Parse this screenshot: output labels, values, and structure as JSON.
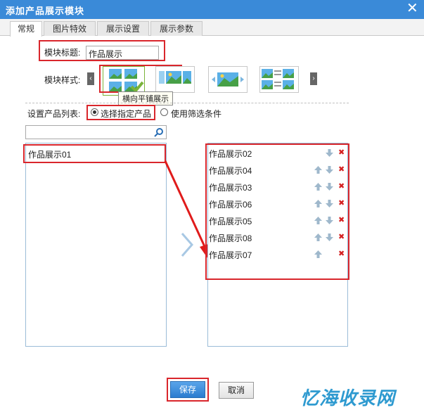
{
  "dialog": {
    "title": "添加产品展示模块",
    "close_glyph": "✕"
  },
  "tabs": [
    {
      "label": "常规",
      "active": true
    },
    {
      "label": "图片特效",
      "active": false
    },
    {
      "label": "展示设置",
      "active": false
    },
    {
      "label": "展示参数",
      "active": false
    }
  ],
  "module_title": {
    "label": "模块标题:",
    "value": "作品展示"
  },
  "module_style": {
    "label": "模块样式:",
    "tooltip": "横向平铺展示",
    "prev_icon": "chevron-left-icon",
    "next_icon": "chevron-right-icon"
  },
  "product_list": {
    "label": "设置产品列表:",
    "option_specific": "选择指定产品",
    "option_filter": "使用筛选条件",
    "selected": "option_specific"
  },
  "search": {
    "value": "",
    "icon": "search-icon"
  },
  "available_items": [
    "作品展示01"
  ],
  "selected_items": [
    "作品展示02",
    "作品展示04",
    "作品展示03",
    "作品展示06",
    "作品展示05",
    "作品展示08",
    "作品展示07"
  ],
  "buttons": {
    "save": "保存",
    "cancel": "取消"
  },
  "watermark": "忆海收录网",
  "colors": {
    "titlebar": "#3a8ad8",
    "highlight": "#d9262c",
    "delete": "#d42020"
  }
}
